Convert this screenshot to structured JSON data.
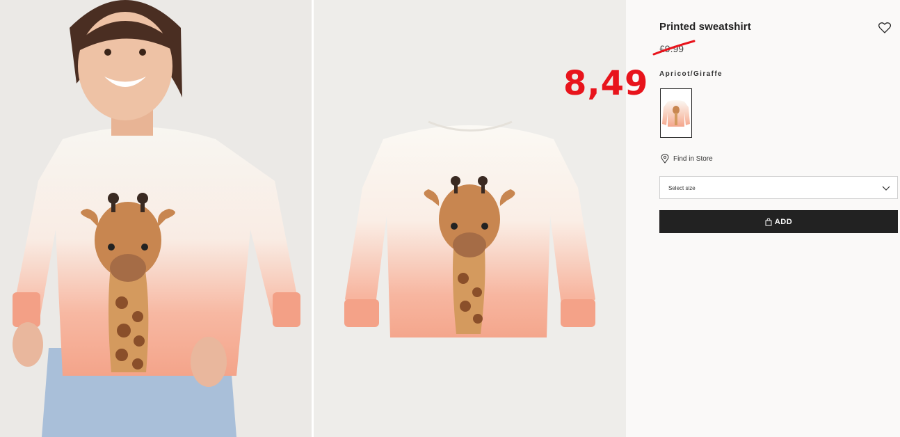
{
  "product": {
    "title": "Printed sweatshirt",
    "old_price": "£9.99",
    "new_price_annotation": "8,49",
    "color_name": "Apricot/Giraffe"
  },
  "actions": {
    "find_in_store": "Find in Store",
    "size_placeholder": "Select size",
    "add_label": "ADD"
  },
  "icons": {
    "favorite": "heart-icon",
    "store": "location-pin-icon",
    "dropdown": "chevron-down-icon",
    "bag": "shopping-bag-icon"
  },
  "colors": {
    "annotation": "#e8141c",
    "button": "#222222",
    "panel": "#faf9f8",
    "apricot": "#f5a98f"
  }
}
